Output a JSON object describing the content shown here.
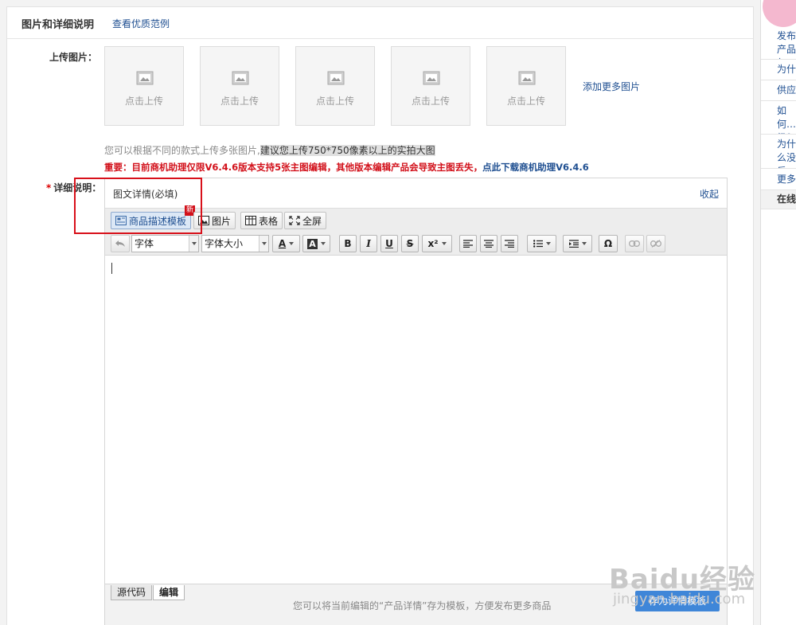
{
  "section": {
    "title": "图片和详细说明",
    "example_link": "查看优质范例"
  },
  "upload": {
    "label": "上传图片：",
    "slots": [
      "点击上传",
      "点击上传",
      "点击上传",
      "点击上传",
      "点击上传"
    ],
    "add_more": "添加更多图片",
    "hint_prefix": "您可以根据不同的款式上传多张图片,",
    "hint_highlight": "建议您上传750*750像素以上的实拍大图",
    "notice_text": "重要：目前商机助理仅限V6.4.6版本支持5张主图编辑，其他版本编辑产品会导致主图丢失，",
    "notice_link": "点此下载商机助理V6.4.6"
  },
  "detail": {
    "required_mark": "*",
    "label": "详细说明：",
    "editor_title": "图文详情(必填)",
    "collapse": "收起",
    "toolbar1": {
      "template": "商品描述模板",
      "new_badge": "新",
      "image": "图片",
      "table": "表格",
      "fullscreen": "全屏"
    },
    "toolbar2": {
      "font_family": "字体",
      "font_size": "字体大小",
      "bold": "B",
      "italic": "I",
      "underline": "U",
      "strike": "S",
      "superscript": "x²",
      "omega": "Ω",
      "font_color_letter": "A",
      "bg_color_letter": "A"
    },
    "modes": [
      "源代码",
      "编辑"
    ],
    "template_tip": "您可以将当前编辑的“产品详情”存为模板，方便发布更多商品",
    "save_template": "存为详情模板"
  },
  "sidebar": {
    "items": [
      "发布产品怎么…",
      "为什么…",
      "供应…",
      "如何…级？",
      "为什么没反…",
      "更多…",
      "在线…"
    ]
  },
  "watermark": {
    "brand": "Baidu经验",
    "url": "jingyan.baidu.com"
  },
  "colors": {
    "notice_red": "#d2101a",
    "link_blue": "#1f4f91",
    "highlight_box": "#d8101a"
  }
}
